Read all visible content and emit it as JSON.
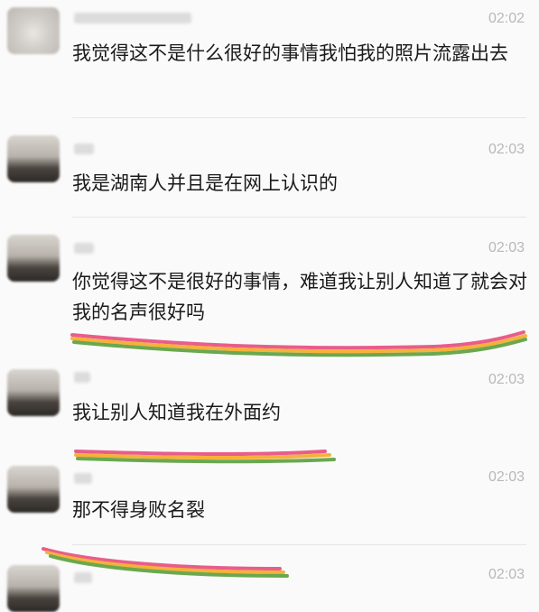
{
  "messages": [
    {
      "time": "02:02",
      "text": "我觉得这不是什么很好的事情我怕我的照片流露出去"
    },
    {
      "time": "02:03",
      "text": "我是湖南人并且是在网上认识的"
    },
    {
      "time": "02:03",
      "text": "你觉得这不是很好的事情，难道我让别人知道了就会对我的名声很好吗"
    },
    {
      "time": "02:03",
      "text": "我让别人知道我在外面约"
    },
    {
      "time": "02:03",
      "text": "那不得身败名裂"
    },
    {
      "time": "02:03",
      "text": ""
    }
  ],
  "colors": {
    "highlight_top": "#e85d8a",
    "highlight_mid": "#f5b13a",
    "highlight_bottom": "#6aa84f"
  }
}
